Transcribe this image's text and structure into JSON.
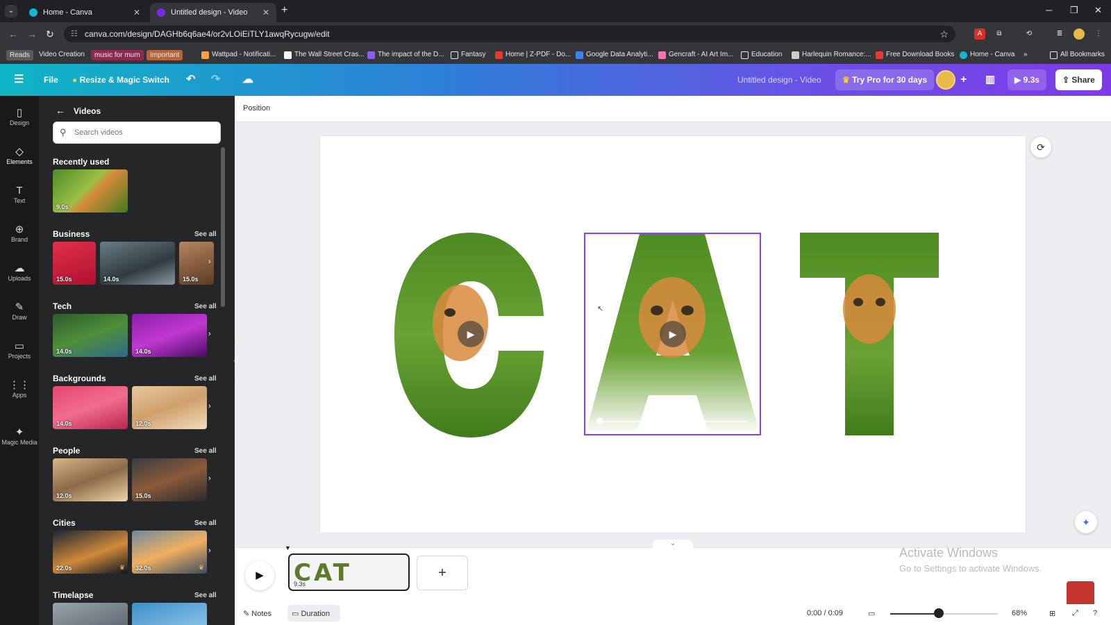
{
  "browser": {
    "tabs": [
      {
        "title": "Home - Canva",
        "active": false
      },
      {
        "title": "Untitled design - Video",
        "active": true
      }
    ],
    "url": "canva.com/design/DAGHb6q6ae4/or2vLOiEiTLY1awqRycugw/edit",
    "bookmarks": [
      {
        "label": "Reads",
        "chip": "#5a5a5a"
      },
      {
        "label": "Video Creation",
        "chip": ""
      },
      {
        "label": "music for mum",
        "chip": "#8e2a4f"
      },
      {
        "label": "Important",
        "chip": "#b5653a"
      },
      {
        "label": "Wattpad - Notificati...",
        "icon": "#f5a24a"
      },
      {
        "label": "The Wall Street Cras...",
        "icon": "#ffffff"
      },
      {
        "label": "The impact of the D...",
        "icon": "#8b5cf6"
      },
      {
        "label": "Fantasy",
        "icon": "folder"
      },
      {
        "label": "Home | Z-PDF - Do...",
        "icon": "#e53935"
      },
      {
        "label": "Google Data Analyti...",
        "icon": "#3b82f6"
      },
      {
        "label": "Gencraft - AI Art Im...",
        "icon": "#f472b6"
      },
      {
        "label": "Education",
        "icon": "folder"
      },
      {
        "label": "Harlequin Romance:...",
        "icon": "#cccccc"
      },
      {
        "label": "Free Download Books",
        "icon": "#e53935"
      },
      {
        "label": "Home - Canva",
        "icon": "#16b6d3"
      }
    ],
    "overflow": "»",
    "all_bookmarks": "All Bookmarks"
  },
  "header": {
    "file": "File",
    "resize": "Resize & Magic Switch",
    "design_title": "Untitled design - Video",
    "try_pro": "Try Pro for 30 days",
    "play_duration": "9.3s",
    "share": "Share"
  },
  "rail": [
    {
      "label": "Design",
      "icon": "▯"
    },
    {
      "label": "Elements",
      "icon": "◇"
    },
    {
      "label": "Text",
      "icon": "T"
    },
    {
      "label": "Brand",
      "icon": "⊕"
    },
    {
      "label": "Uploads",
      "icon": "☁"
    },
    {
      "label": "Draw",
      "icon": "✎"
    },
    {
      "label": "Projects",
      "icon": "▭"
    },
    {
      "label": "Apps",
      "icon": "⋮⋮"
    },
    {
      "label": "Magic Media",
      "icon": "✦"
    }
  ],
  "panel": {
    "title": "Videos",
    "search_placeholder": "Search videos",
    "see_all": "See all",
    "recently_used": {
      "title": "Recently used",
      "durations": [
        "9.0s"
      ]
    },
    "sections": [
      {
        "title": "Business",
        "durations": [
          "15.0s",
          "14.0s",
          "15.0s"
        ]
      },
      {
        "title": "Tech",
        "durations": [
          "14.0s",
          "14.0s"
        ]
      },
      {
        "title": "Backgrounds",
        "durations": [
          "14.0s",
          "12.0s"
        ]
      },
      {
        "title": "People",
        "durations": [
          "12.0s",
          "15.0s"
        ]
      },
      {
        "title": "Cities",
        "durations": [
          "22.0s",
          "32.0s"
        ]
      },
      {
        "title": "Timelapse",
        "durations": []
      }
    ]
  },
  "editor": {
    "position_label": "Position"
  },
  "timeline": {
    "clip_text": "CAT CAT",
    "clip_duration": "9.3s",
    "add_page": "+",
    "activate_title": "Activate Windows",
    "activate_sub": "Go to Settings to activate Windows."
  },
  "bottom": {
    "notes": "Notes",
    "duration": "Duration",
    "time": "0:00 / 0:09",
    "zoom": "68%",
    "zoom_fraction": 0.45
  }
}
